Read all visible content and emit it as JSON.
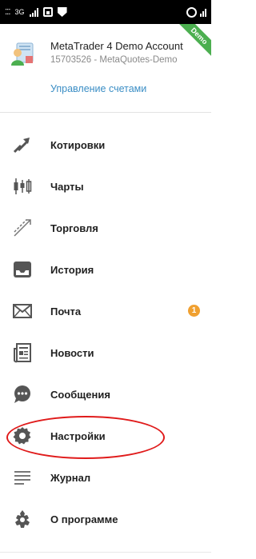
{
  "status_bar": {
    "left_dots": "⁚⁚⁚",
    "network": "3G"
  },
  "account": {
    "name": "MetaTrader 4 Demo Account",
    "server": "15703526 - MetaQuotes-Demo",
    "manage_label": "Управление счетами",
    "ribbon_label": "Demo"
  },
  "menu": {
    "items": [
      {
        "label": "Котировки",
        "icon": "quotes-icon"
      },
      {
        "label": "Чарты",
        "icon": "charts-icon"
      },
      {
        "label": "Торговля",
        "icon": "trade-icon"
      },
      {
        "label": "История",
        "icon": "history-icon"
      },
      {
        "label": "Почта",
        "icon": "mail-icon",
        "badge": "1"
      },
      {
        "label": "Новости",
        "icon": "news-icon"
      },
      {
        "label": "Сообщения",
        "icon": "messages-icon"
      },
      {
        "label": "Настройки",
        "icon": "settings-icon"
      },
      {
        "label": "Журнал",
        "icon": "journal-icon"
      },
      {
        "label": "О программе",
        "icon": "about-icon"
      }
    ]
  },
  "colors": {
    "accent": "#3b8ec5",
    "badge": "#f0a030",
    "ribbon": "#4caf50",
    "highlight": "#e01b1b",
    "icon": "#555555"
  }
}
